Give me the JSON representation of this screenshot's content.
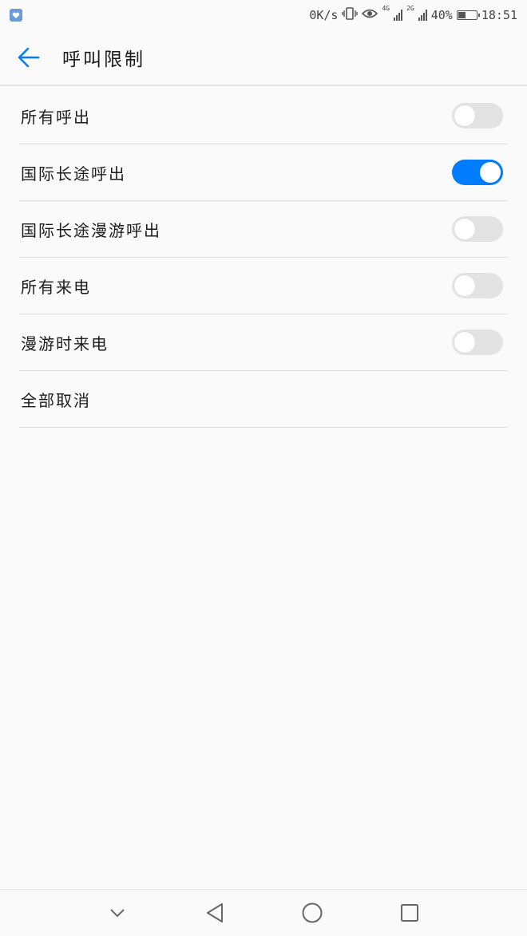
{
  "status_bar": {
    "speed": "0K/s",
    "net1": "4G",
    "net2": "2G",
    "battery_level": 0.4,
    "battery_text": "40%",
    "time": "18:51"
  },
  "header": {
    "title": "呼叫限制"
  },
  "settings": [
    {
      "label": "所有呼出",
      "enabled": false
    },
    {
      "label": "国际长途呼出",
      "enabled": true
    },
    {
      "label": "国际长途漫游呼出",
      "enabled": false
    },
    {
      "label": "所有来电",
      "enabled": false
    },
    {
      "label": "漫游时来电",
      "enabled": false
    }
  ],
  "cancel_all_label": "全部取消",
  "colors": {
    "accent": "#007dff",
    "switch_off": "#e3e3e3",
    "background": "#fafafa"
  },
  "nav_icons": [
    "chevron-down-icon",
    "back-triangle-icon",
    "home-circle-icon",
    "recents-square-icon"
  ]
}
